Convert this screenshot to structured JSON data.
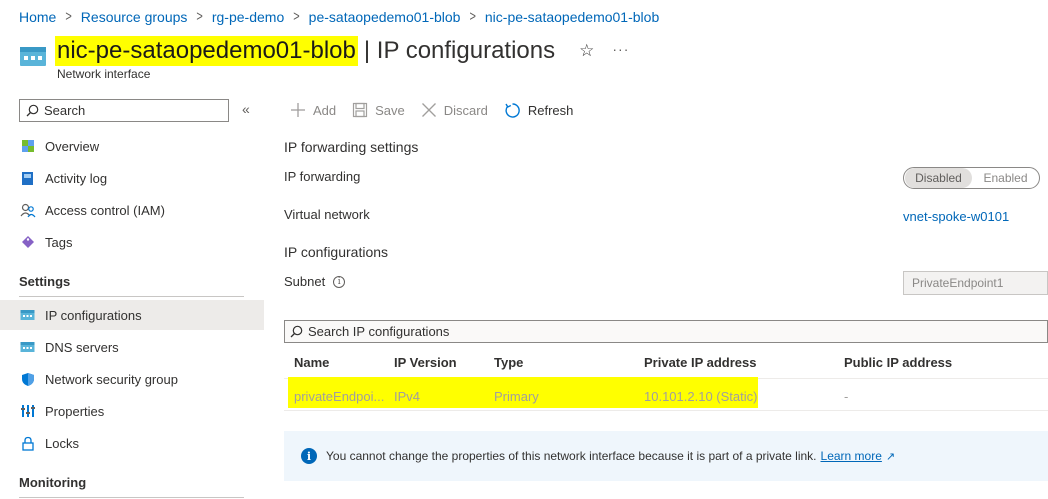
{
  "breadcrumb": {
    "items": [
      "Home",
      "Resource groups",
      "rg-pe-demo",
      "pe-sataopedemo01-blob",
      "nic-pe-sataopedemo01-blob"
    ],
    "separator": ">"
  },
  "header": {
    "resource_name": "nic-pe-sataopedemo01-blob",
    "page_title": "| IP configurations",
    "resource_type": "Network interface",
    "favorite_icon": "☆",
    "more_icon": "···"
  },
  "sidebar": {
    "search_placeholder": "Search",
    "collapse_icon": "«",
    "items": [
      {
        "label": "Overview",
        "icon": "overview-icon"
      },
      {
        "label": "Activity log",
        "icon": "activity-log-icon"
      },
      {
        "label": "Access control (IAM)",
        "icon": "iam-icon"
      },
      {
        "label": "Tags",
        "icon": "tag-icon"
      }
    ],
    "settings_heading": "Settings",
    "settings_items": [
      {
        "label": "IP configurations",
        "icon": "ip-config-icon",
        "active": true
      },
      {
        "label": "DNS servers",
        "icon": "dns-icon"
      },
      {
        "label": "Network security group",
        "icon": "shield-icon"
      },
      {
        "label": "Properties",
        "icon": "properties-icon"
      },
      {
        "label": "Locks",
        "icon": "lock-icon"
      }
    ],
    "monitoring_heading": "Monitoring"
  },
  "toolbar": {
    "add_label": "Add",
    "save_label": "Save",
    "discard_label": "Discard",
    "refresh_label": "Refresh"
  },
  "main": {
    "forwarding_heading": "IP forwarding settings",
    "forwarding_label": "IP forwarding",
    "toggle_options": [
      "Disabled",
      "Enabled"
    ],
    "toggle_selected": "Disabled",
    "vnet_label": "Virtual network",
    "vnet_value": "vnet-spoke-w0101",
    "ipconfig_heading": "IP configurations",
    "subnet_label": "Subnet",
    "subnet_value": "PrivateEndpoint1",
    "table_search_placeholder": "Search IP configurations",
    "table": {
      "columns": [
        "Name",
        "IP Version",
        "Type",
        "Private IP address",
        "Public IP address"
      ],
      "rows": [
        [
          "privateEndpoi...",
          "IPv4",
          "Primary",
          "10.101.2.10 (Static)",
          "-"
        ]
      ]
    },
    "info_message": "You cannot change the properties of this network interface because it is part of a private link.",
    "info_link": "Learn more",
    "info_link_icon": "↗"
  },
  "colors": {
    "link": "#0067b8",
    "highlight": "#ffff00",
    "active_nav_bg": "#edebe9",
    "info_bg": "#eff6fc"
  }
}
